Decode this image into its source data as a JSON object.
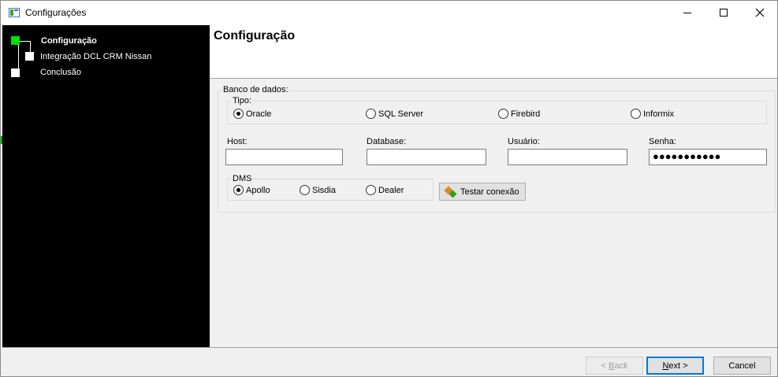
{
  "window": {
    "title": "Configurações"
  },
  "steps": [
    {
      "label": "Configuração",
      "active": true
    },
    {
      "label": "Integração DCL CRM Nissan",
      "active": false
    },
    {
      "label": "Conclusão",
      "active": false
    }
  ],
  "header": {
    "title": "Configuração"
  },
  "database": {
    "group_label": "Banco de dados:",
    "tipo_label": "Tipo:",
    "types": [
      {
        "label": "Oracle",
        "checked": true
      },
      {
        "label": "SQL Server",
        "checked": false
      },
      {
        "label": "Firebird",
        "checked": false
      },
      {
        "label": "Informix",
        "checked": false
      }
    ],
    "fields": {
      "host": {
        "label": "Host:",
        "value": ""
      },
      "database": {
        "label": "Database:",
        "value": ""
      },
      "usuario": {
        "label": "Usuário:",
        "value": ""
      },
      "senha": {
        "label": "Senha:",
        "value": "●●●●●●●●●●●"
      }
    },
    "dms_label": "DMS",
    "dms": [
      {
        "label": "Apollo",
        "checked": true
      },
      {
        "label": "Sisdia",
        "checked": false
      },
      {
        "label": "Dealer",
        "checked": false
      }
    ],
    "test_button": "Testar conexão"
  },
  "footer": {
    "back": {
      "prefix": "< ",
      "accel": "B",
      "rest": "ack"
    },
    "next": {
      "accel": "N",
      "rest": "ext >"
    },
    "cancel": "Cancel"
  }
}
